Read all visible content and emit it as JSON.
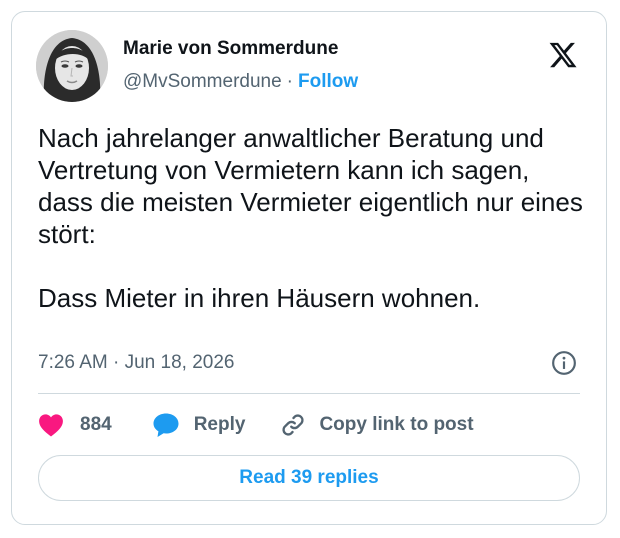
{
  "author": {
    "name": "Marie von Sommerdune",
    "handle": "@MvSommerdune",
    "separator": "·",
    "follow_label": "Follow",
    "avatar_icon": "portrait-avatar"
  },
  "tweet": {
    "text": "Nach jahrelanger anwaltlicher Beratung und Vertretung von Vermietern kann ich sagen, dass die meisten Vermieter eigentlich nur eines stört:\n\nDass Mieter in ihren Häusern wohnen.",
    "timestamp": "7:26 AM · Jun 18, 2026"
  },
  "actions": {
    "likes": "884",
    "reply_label": "Reply",
    "copy_link_label": "Copy link to post"
  },
  "footer": {
    "read_replies_label": "Read 39 replies"
  },
  "colors": {
    "accent": "#1d9bf0",
    "like": "#f91880",
    "text": "#0f1419",
    "muted": "#536471",
    "border": "#cfd9de"
  },
  "icons": [
    "x-logo-icon",
    "info-icon",
    "heart-icon",
    "reply-bubble-icon",
    "link-icon"
  ]
}
